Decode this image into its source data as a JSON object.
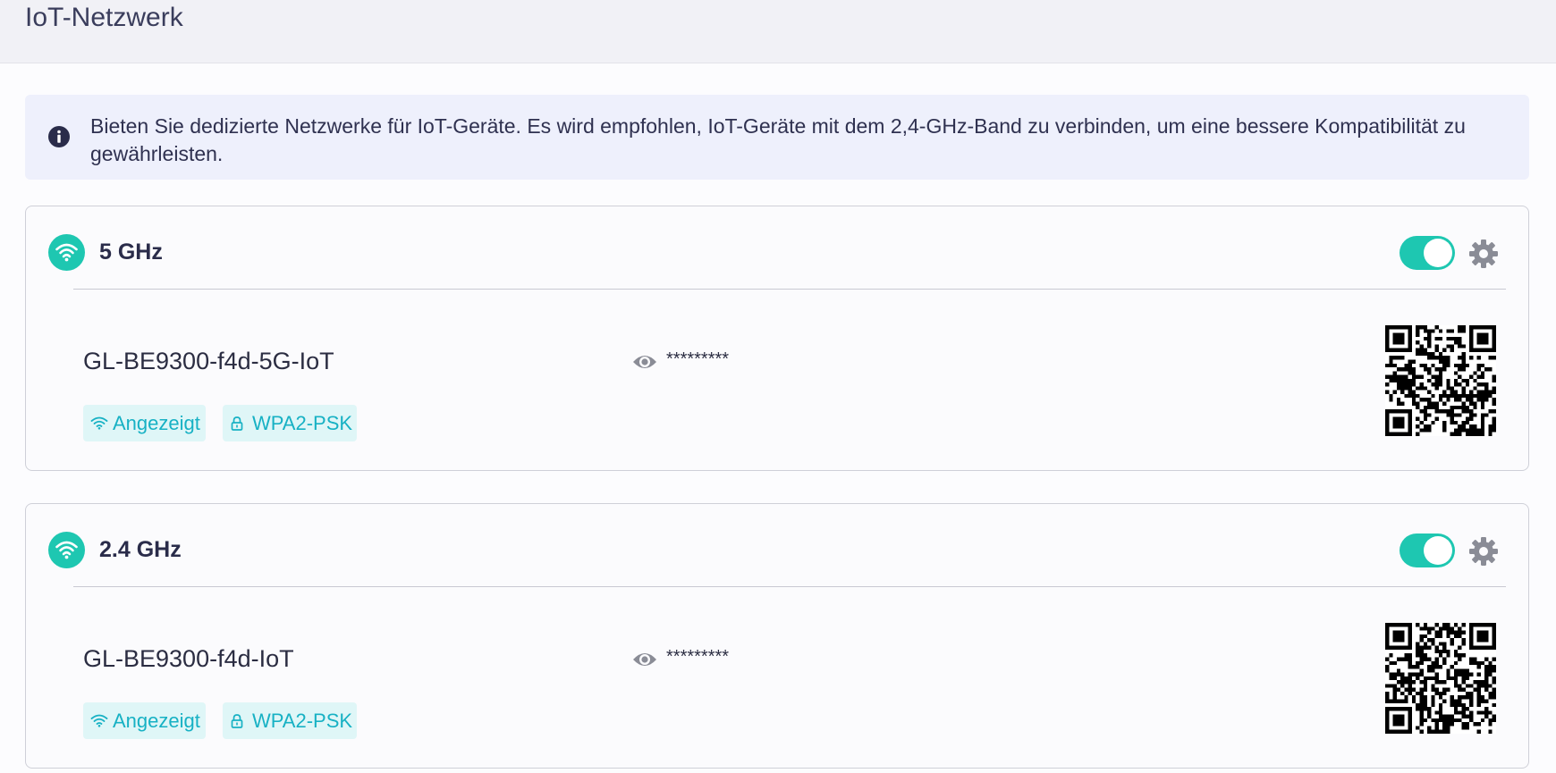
{
  "page": {
    "title": "IoT-Netzwerk"
  },
  "info": {
    "text": "Bieten Sie dedizierte Netzwerke für IoT-Geräte. Es wird empfohlen, IoT-Geräte mit dem 2,4-GHz-Band zu verbinden, um eine bessere Kompatibilität zu gewährleisten.",
    "icon": "info-circle-icon"
  },
  "colors": {
    "accent": "#1ec7b1",
    "tag_text": "#17b1c4",
    "tag_bg": "#dff6f7",
    "info_bg": "#eef0fc"
  },
  "networks": [
    {
      "band": "5 GHz",
      "enabled": true,
      "ssid": "GL-BE9300-f4d-5G-IoT",
      "password_masked": "*********",
      "tags": [
        {
          "label": "Angezeigt",
          "icon": "wifi-broadcast-icon"
        },
        {
          "label": "WPA2-PSK",
          "icon": "lock-icon"
        }
      ]
    },
    {
      "band": "2.4 GHz",
      "enabled": true,
      "ssid": "GL-BE9300-f4d-IoT",
      "password_masked": "*********",
      "tags": [
        {
          "label": "Angezeigt",
          "icon": "wifi-broadcast-icon"
        },
        {
          "label": "WPA2-PSK",
          "icon": "lock-icon"
        }
      ]
    }
  ]
}
